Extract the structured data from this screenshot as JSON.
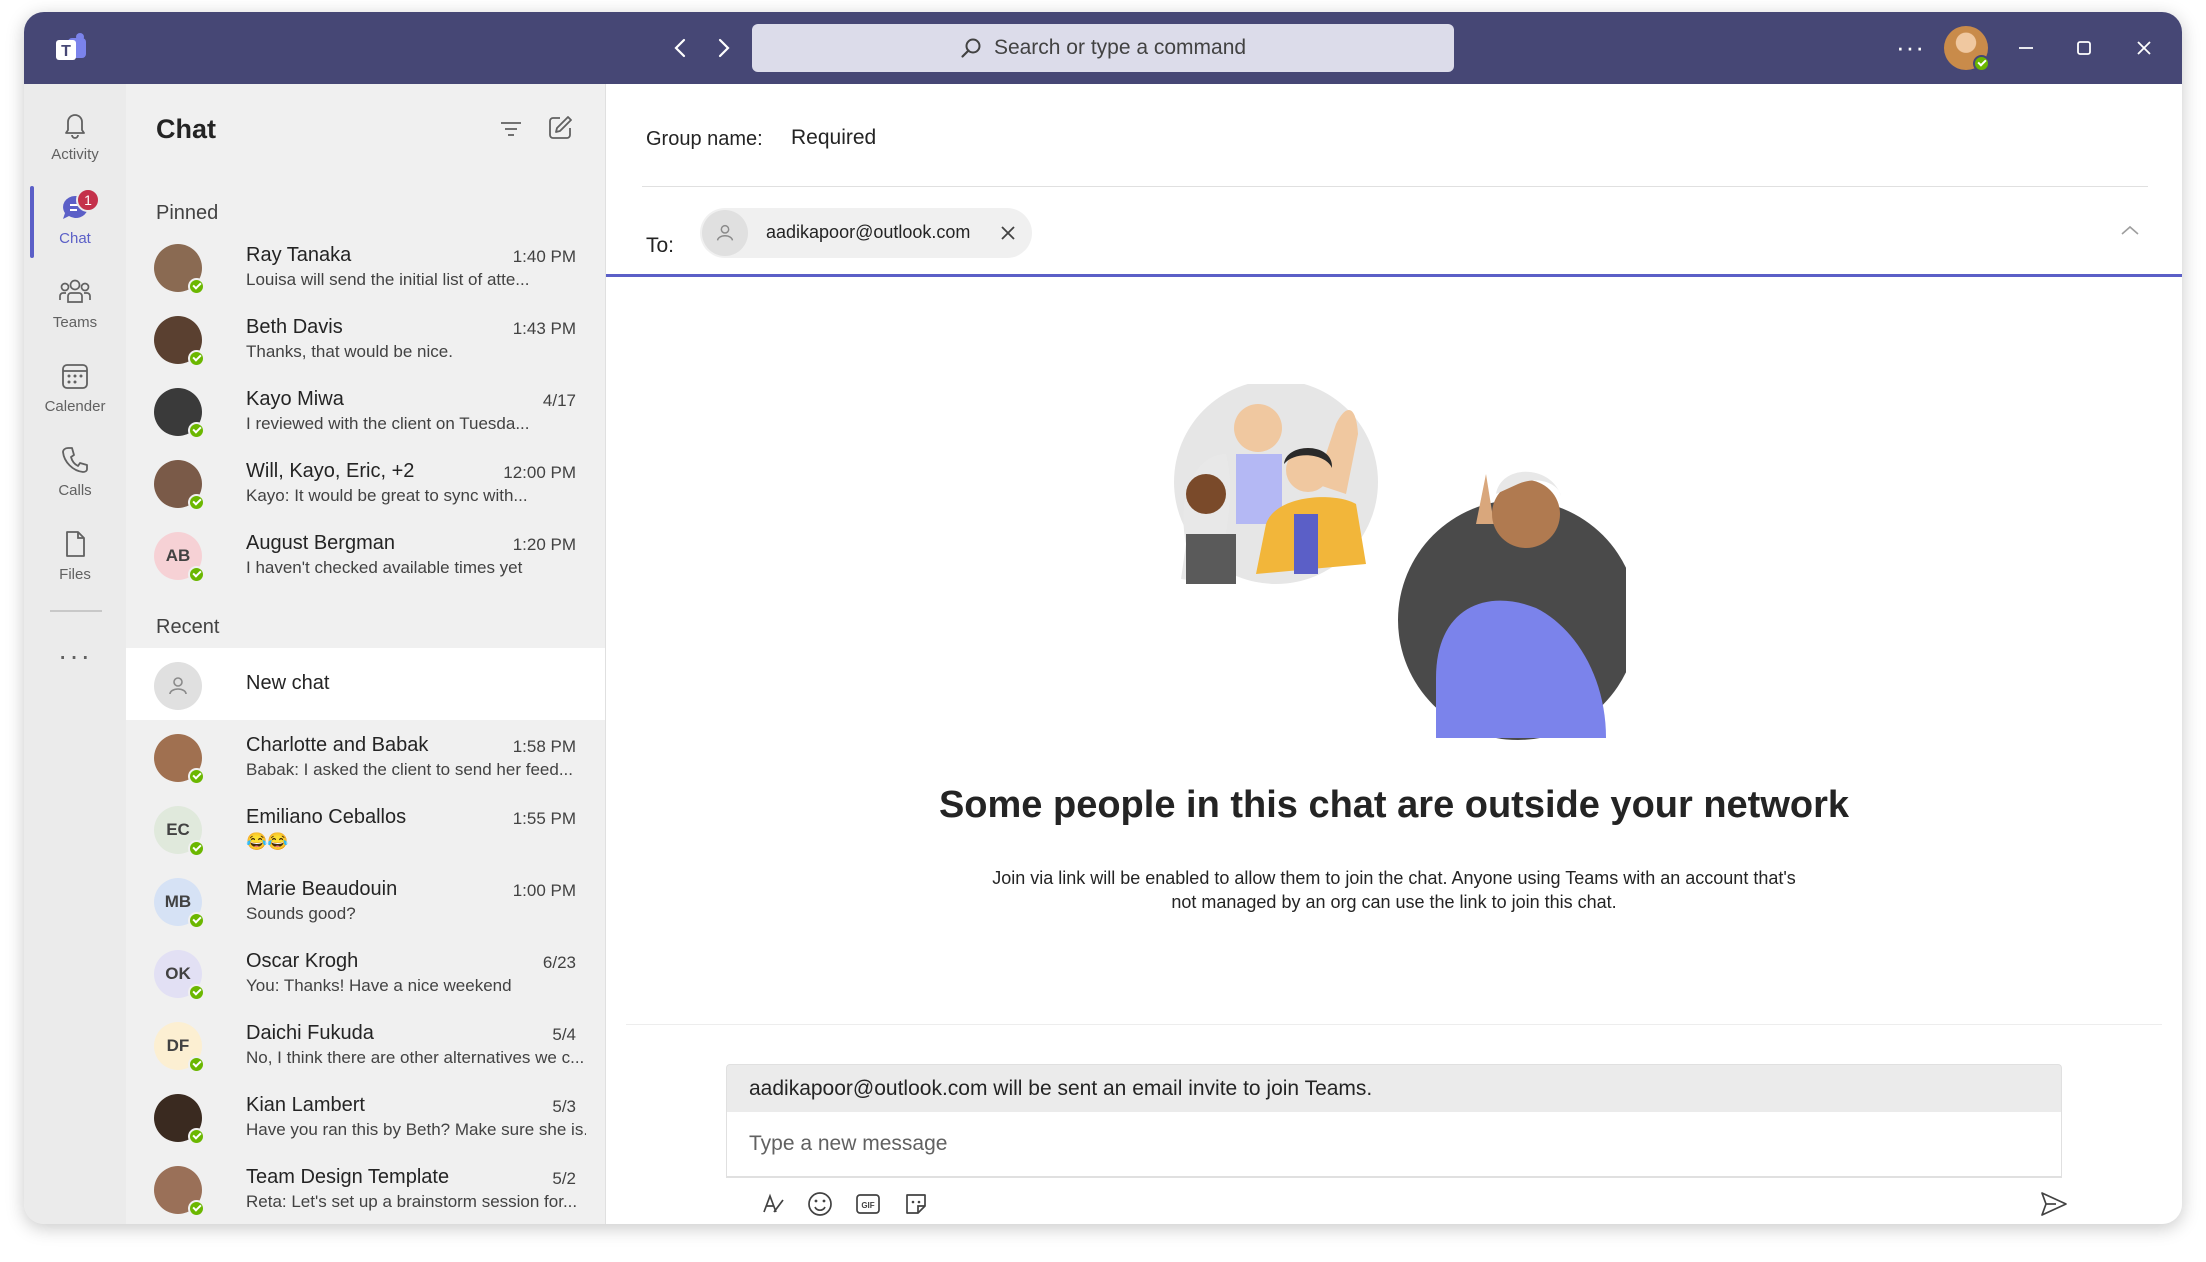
{
  "titlebar": {
    "search_placeholder": "Search or type a command",
    "more_label": "···"
  },
  "rail": {
    "items": [
      {
        "label": "Activity",
        "icon": "bell-icon"
      },
      {
        "label": "Chat",
        "icon": "chat-icon",
        "badge": "1"
      },
      {
        "label": "Teams",
        "icon": "teams-icon"
      },
      {
        "label": "Calender",
        "icon": "calendar-icon"
      },
      {
        "label": "Calls",
        "icon": "phone-icon"
      },
      {
        "label": "Files",
        "icon": "file-icon"
      }
    ],
    "more_label": "···"
  },
  "chat_list": {
    "title": "Chat",
    "pinned_label": "Pinned",
    "recent_label": "Recent",
    "pinned": [
      {
        "name": "Ray Tanaka",
        "time": "1:40 PM",
        "preview": "Louisa will send the initial list of atte...",
        "initials": "",
        "color": "#8a6a52"
      },
      {
        "name": "Beth Davis",
        "time": "1:43 PM",
        "preview": "Thanks, that would be nice.",
        "initials": "",
        "color": "#5a4030"
      },
      {
        "name": "Kayo Miwa",
        "time": "4/17",
        "preview": "I reviewed with the client on Tuesda...",
        "initials": "",
        "color": "#3a3a3a"
      },
      {
        "name": "Will, Kayo, Eric, +2",
        "time": "12:00 PM",
        "preview": "Kayo: It would be great to sync with...",
        "initials": "",
        "color": "#7a5a48"
      },
      {
        "name": "August Bergman",
        "time": "1:20 PM",
        "preview": "I haven't checked available times yet",
        "initials": "AB",
        "color": "#f6d1d5"
      }
    ],
    "new_chat_label": "New chat",
    "recent": [
      {
        "name": "Charlotte and Babak",
        "time": "1:58 PM",
        "preview": "Babak: I asked the client to send her feed...",
        "initials": "",
        "color": "#a07050"
      },
      {
        "name": "Emiliano Ceballos",
        "time": "1:55 PM",
        "preview": "😂😂",
        "initials": "EC",
        "color": "#e0e9dc"
      },
      {
        "name": "Marie Beaudouin",
        "time": "1:00 PM",
        "preview": "Sounds good?",
        "initials": "MB",
        "color": "#d6e2f5"
      },
      {
        "name": "Oscar Krogh",
        "time": "6/23",
        "preview": "You: Thanks! Have a nice weekend",
        "initials": "OK",
        "color": "#e2e0f4"
      },
      {
        "name": "Daichi Fukuda",
        "time": "5/4",
        "preview": "No, I think there are other alternatives we c...",
        "initials": "DF",
        "color": "#fcefd2"
      },
      {
        "name": "Kian Lambert",
        "time": "5/3",
        "preview": "Have you ran this by Beth? Make sure she is...",
        "initials": "",
        "color": "#3a2a20"
      },
      {
        "name": "Team Design Template",
        "time": "5/2",
        "preview": "Reta: Let's set up a brainstorm session for...",
        "initials": "",
        "color": "#9a7058"
      }
    ]
  },
  "main": {
    "group_name_label": "Group name:",
    "group_name_value": "Required",
    "to_label": "To:",
    "recipient": "aadikapoor@outlook.com",
    "headline": "Some people in this chat are outside your network",
    "sub_line1": "Join via link will be enabled to allow them to join the chat. Anyone using Teams with an account that's",
    "sub_line2": "not managed by an org can use the link to join this chat.",
    "invite_notice": "aadikapoor@outlook.com will be sent an email invite to join Teams.",
    "message_placeholder": "Type a new message"
  },
  "colors": {
    "titlebar": "#464775",
    "accent": "#5b5fc7",
    "presence_available": "#6bb700",
    "badge": "#c4314b"
  }
}
